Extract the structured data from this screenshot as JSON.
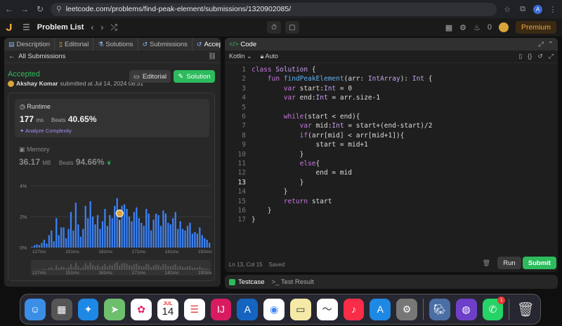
{
  "browser": {
    "url": "leetcode.com/problems/find-peak-element/submissions/1320902085/",
    "profile_initial": "A"
  },
  "topbar": {
    "problem_list": "Problem List",
    "streak": "0",
    "premium": "Premium"
  },
  "left": {
    "tabs": [
      {
        "label": "Description",
        "icon": "file-icon"
      },
      {
        "label": "Editorial",
        "icon": "book-icon"
      },
      {
        "label": "Solutions",
        "icon": "flask-icon"
      },
      {
        "label": "Submissions",
        "icon": "history-icon"
      },
      {
        "label": "Accepted",
        "icon": "history-icon"
      }
    ],
    "all_submissions": "All Submissions",
    "status": "Accepted",
    "user": "Akshay Komar",
    "submitted_text": "submitted at Jul 14, 2024 08:31",
    "editorial_btn": "Editorial",
    "solution_btn": "Solution",
    "runtime": {
      "label": "Runtime",
      "value": "177",
      "unit": "ms",
      "beats_label": "Beats",
      "beats": "40.65%",
      "analyze": "Analyze Complexity"
    },
    "memory": {
      "label": "Memory",
      "value": "36.17",
      "unit": "MB",
      "beats_label": "Beats",
      "beats": "94.66%"
    }
  },
  "chart_data": {
    "type": "bar",
    "y_ticks": [
      "4%",
      "2%",
      "0%"
    ],
    "ylim": [
      0,
      4
    ],
    "x_ticks": [
      "127ms",
      "151ms",
      "161ms",
      "171ms",
      "181ms",
      "192ms"
    ],
    "highlight_index": 36,
    "colors": {
      "bar": "#3b82f6",
      "highlight": "#6aa7ff"
    },
    "values": [
      0.05,
      0.15,
      0.2,
      0.15,
      0.3,
      0.5,
      0.25,
      0.8,
      1.1,
      0.4,
      1.9,
      0.8,
      1.3,
      1.3,
      0.6,
      1.2,
      2.3,
      1.1,
      2.9,
      1.5,
      0.7,
      1.2,
      2.7,
      1.9,
      3.0,
      2.0,
      1.5,
      2.1,
      1.2,
      1.7,
      2.5,
      1.4,
      2.1,
      1.9,
      2.7,
      3.2,
      1.8,
      2.7,
      2.8,
      2.5,
      2.0,
      1.7,
      2.3,
      2.6,
      1.9,
      1.6,
      1.4,
      2.5,
      2.2,
      1.1,
      1.8,
      2.2,
      2.1,
      1.4,
      2.4,
      2.2,
      1.6,
      1.5,
      1.9,
      2.3,
      1.2,
      1.7,
      1.2,
      1.1,
      1.4,
      1.6,
      0.9,
      1.0,
      0.9,
      1.3,
      0.8,
      0.6,
      0.5,
      0.3
    ]
  },
  "editor": {
    "title": "Code",
    "language": "Kotlin",
    "auto": "Auto",
    "lines": [
      "class Solution {",
      "    fun findPeakElement(arr: IntArray): Int {",
      "        var start:Int = 0",
      "        var end:Int = arr.size-1",
      "",
      "        while(start < end){",
      "            var mid:Int = start+(end-start)/2",
      "            if(arr[mid] < arr[mid+1]){",
      "                start = mid+1",
      "            }",
      "            else{",
      "                end = mid",
      "            }",
      "        }",
      "        return start",
      "    }",
      "}"
    ],
    "current_line": 13,
    "status": "Ln 13, Col 15",
    "saved": "Saved",
    "run": "Run",
    "submit": "Submit"
  },
  "testpanel": {
    "testcase": "Testcase",
    "result": "Test Result"
  },
  "dock": {
    "calendar_month": "JUL",
    "calendar_day": "14",
    "whatsapp_badge": "1"
  }
}
